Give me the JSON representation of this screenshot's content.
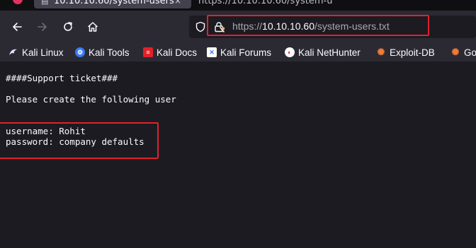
{
  "tabs": {
    "active_title": "10.10.10.60/system-users",
    "close_glyph": "×",
    "inactive_title": "https://10.10.10.60/system-u"
  },
  "urlbar": {
    "scheme": "https://",
    "host": "10.10.10.60",
    "path": "/system-users.txt"
  },
  "bookmarks": [
    {
      "label": "Kali Linux",
      "icon": "kali-dragon-icon",
      "color": "#dfe2ff"
    },
    {
      "label": "Kali Tools",
      "icon": "kali-tools-icon",
      "color": "#367bf0"
    },
    {
      "label": "Kali Docs",
      "icon": "kali-docs-icon",
      "color": "#e0212b"
    },
    {
      "label": "Kali Forums",
      "icon": "kali-forums-icon",
      "color": "#367bf0"
    },
    {
      "label": "Kali NetHunter",
      "icon": "nethunter-icon",
      "color": "#e0212b"
    },
    {
      "label": "Exploit-DB",
      "icon": "exploit-db-icon",
      "color": "#ef7b3a"
    },
    {
      "label": "Go",
      "icon": "ghdb-icon",
      "color": "#ef7b3a"
    }
  ],
  "content": {
    "line1": "####Support ticket###",
    "line2": "Please create the following user",
    "line3": "username: Rohit",
    "line4": "password: company defaults"
  },
  "colors": {
    "accent_highlight": "#e0212b",
    "chrome_bg": "#2b2a33",
    "page_bg": "#1c1b22"
  }
}
